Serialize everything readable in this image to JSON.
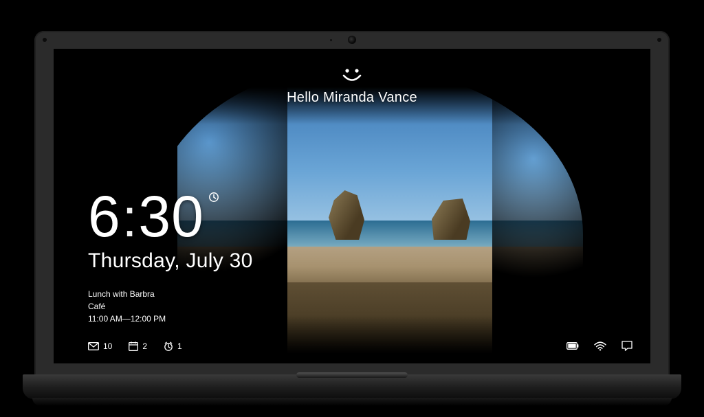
{
  "greeting": {
    "text": "Hello Miranda Vance",
    "icon": "smile-icon"
  },
  "clock": {
    "hour": "6",
    "minute": "30",
    "date": "Thursday, July 30"
  },
  "quick_status": {
    "event_title": "Lunch with Barbra",
    "event_location": "Café",
    "event_time_range": "11:00 AM—12:00 PM"
  },
  "status_badges": {
    "mail_count": "10",
    "calendar_count": "2",
    "alarm_count": "1"
  },
  "system_tray": {
    "battery_icon": "battery-icon",
    "wifi_icon": "wifi-icon",
    "action_center_icon": "action-center-icon"
  }
}
